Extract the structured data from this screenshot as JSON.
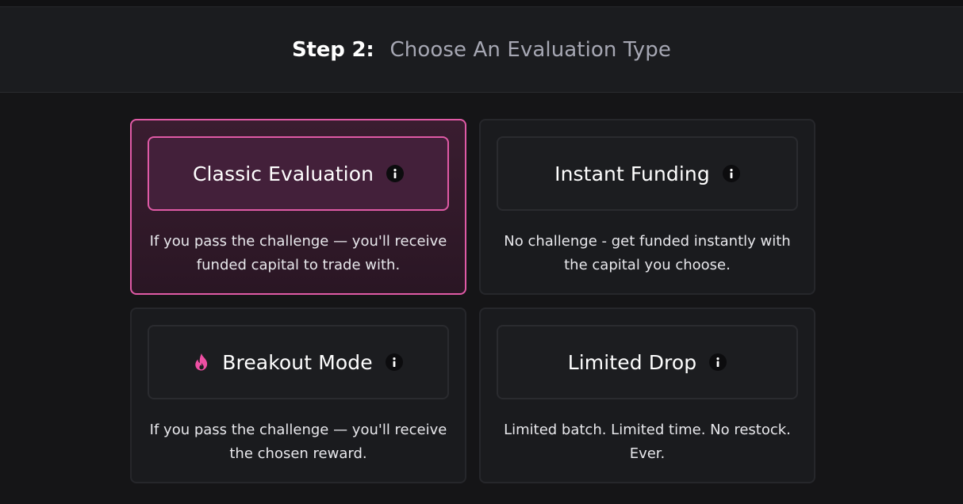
{
  "header": {
    "step_label": "Step 2:",
    "step_title": "Choose An Evaluation Type"
  },
  "options": [
    {
      "title": "Classic Evaluation",
      "description": "If you pass the challenge — you'll receive funded capital to trade with.",
      "selected": true,
      "icon": "info-icon"
    },
    {
      "title": "Instant Funding",
      "description": "No challenge - get funded instantly with the capital you choose.",
      "selected": false,
      "icon": "info-icon"
    },
    {
      "title": "Breakout Mode",
      "description": "If you pass the challenge — you'll receive the chosen reward.",
      "selected": false,
      "leading_icon": "fire-icon",
      "icon": "info-icon"
    },
    {
      "title": "Limited Drop",
      "description": "Limited batch. Limited time. No restock. Ever.",
      "selected": false,
      "icon": "info-icon"
    }
  ],
  "colors": {
    "accent": "#e05aa6",
    "background": "#151517",
    "card": "#1a1b1e",
    "muted_text": "#a6a7b3"
  }
}
